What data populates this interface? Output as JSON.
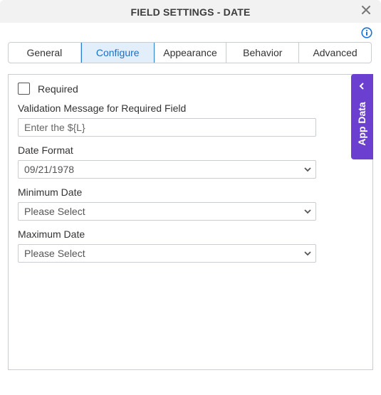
{
  "dialog": {
    "title": "FIELD SETTINGS - DATE",
    "close_icon": "close-icon",
    "info_icon": "info-icon"
  },
  "tabs": [
    {
      "label": "General",
      "active": false
    },
    {
      "label": "Configure",
      "active": true
    },
    {
      "label": "Appearance",
      "active": false
    },
    {
      "label": "Behavior",
      "active": false
    },
    {
      "label": "Advanced",
      "active": false
    }
  ],
  "form": {
    "required": {
      "label": "Required",
      "checked": false
    },
    "validation_message": {
      "label": "Validation Message for Required Field",
      "placeholder": "Enter the ${L}",
      "value": ""
    },
    "date_format": {
      "label": "Date Format",
      "value": "09/21/1978"
    },
    "minimum_date": {
      "label": "Minimum Date",
      "value": "Please Select"
    },
    "maximum_date": {
      "label": "Maximum Date",
      "value": "Please Select"
    }
  },
  "app_data": {
    "label": "App Data",
    "icon": "chevron-left-icon",
    "color": "#6b3fd0"
  },
  "colors": {
    "accent": "#2c7fd0",
    "active_tab_bg": "#e2effb"
  }
}
